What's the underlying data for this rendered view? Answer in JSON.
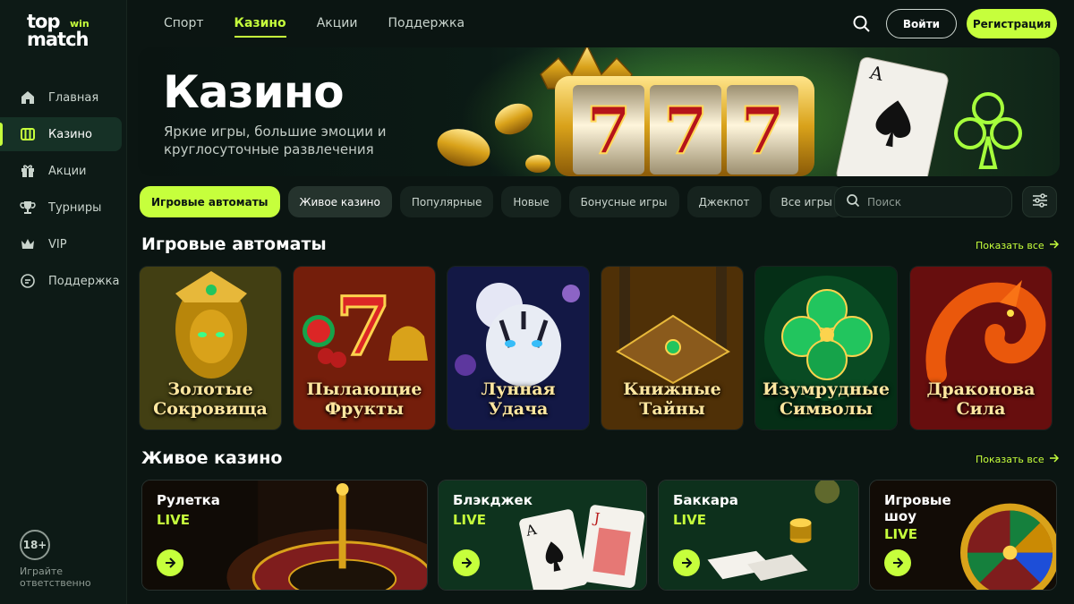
{
  "brand": {
    "logo_top": "top",
    "logo_win": "win",
    "logo_bottom": "match"
  },
  "sidebar": {
    "items": [
      {
        "label": "Главная",
        "icon": "home-icon"
      },
      {
        "label": "Казино",
        "icon": "slot-machine-icon"
      },
      {
        "label": "Акции",
        "icon": "gift-icon"
      },
      {
        "label": "Турниры",
        "icon": "trophy-icon"
      },
      {
        "label": "VIP",
        "icon": "crown-icon"
      },
      {
        "label": "Поддержка",
        "icon": "chat-icon"
      }
    ],
    "active_index": 1,
    "age_badge": "18+",
    "responsible_text": "Играйте ответственно"
  },
  "topnav": {
    "items": [
      "Спорт",
      "Казино",
      "Акции",
      "Поддержка"
    ],
    "active_index": 1,
    "login_label": "Войти",
    "register_label": "Регистрация"
  },
  "hero": {
    "title": "Казино",
    "subtitle": "Яркие игры, большие эмоции и круглосуточные развлечения"
  },
  "filters": {
    "chips": [
      "Игровые автоматы",
      "Живое казино",
      "Популярные",
      "Новые",
      "Бонусные игры",
      "Джекпот",
      "Все игры"
    ],
    "search_placeholder": "Поиск"
  },
  "slots_section": {
    "title": "Игровые автоматы",
    "show_all": "Показать все",
    "games": [
      {
        "line1": "Золотые",
        "line2": "Сокровища"
      },
      {
        "line1": "Пылающие",
        "line2": "Фрукты"
      },
      {
        "line1": "Лунная",
        "line2": "Удача"
      },
      {
        "line1": "Книжные",
        "line2": "Тайны"
      },
      {
        "line1": "Изумрудные",
        "line2": "Символы"
      },
      {
        "line1": "Драконова",
        "line2": "Сила"
      }
    ]
  },
  "live_section": {
    "title": "Живое казино",
    "show_all": "Показать все",
    "games": [
      {
        "name": "Рулетка",
        "live": "LIVE"
      },
      {
        "name": "Блэкджек",
        "live": "LIVE"
      },
      {
        "name": "Баккара",
        "live": "LIVE"
      },
      {
        "name": "Игровые шоу",
        "live": "LIVE"
      }
    ]
  },
  "colors": {
    "accent": "#c6ff3c",
    "background": "#0b1512",
    "sidebar": "#0d1a16"
  }
}
